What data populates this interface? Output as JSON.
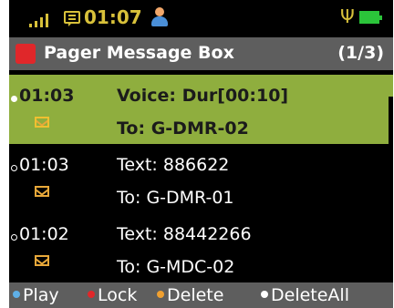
{
  "status_bar": {
    "time": "01:07",
    "icons": [
      "signal-icon",
      "message-icon",
      "person-icon",
      "usb-icon",
      "battery-icon"
    ]
  },
  "title_bar": {
    "title": "Pager Message Box",
    "page": "(1/3)"
  },
  "messages": [
    {
      "time": "01:03",
      "line1": "Voice: Dur[00:10]",
      "line2": "To: G-DMR-02",
      "selected": true
    },
    {
      "time": "01:03",
      "line1": "Text: 886622",
      "line2": "To: G-DMR-01",
      "selected": false
    },
    {
      "time": "01:02",
      "line1": "Text: 88442266",
      "line2": "To: G-MDC-02",
      "selected": false
    }
  ],
  "softkeys": {
    "play": {
      "label": "Play",
      "color": "#5fb0e8"
    },
    "lock": {
      "label": "Lock",
      "color": "#e0272a"
    },
    "delete": {
      "label": "Delete",
      "color": "#f0a030"
    },
    "delete_all": {
      "label": "DeleteAll",
      "color": "#ffffff"
    }
  },
  "colors": {
    "screen_bg": "#000000",
    "bar_bg": "#5e5e5e",
    "selection": "#8fae3e",
    "status_text": "#d8c13a"
  }
}
